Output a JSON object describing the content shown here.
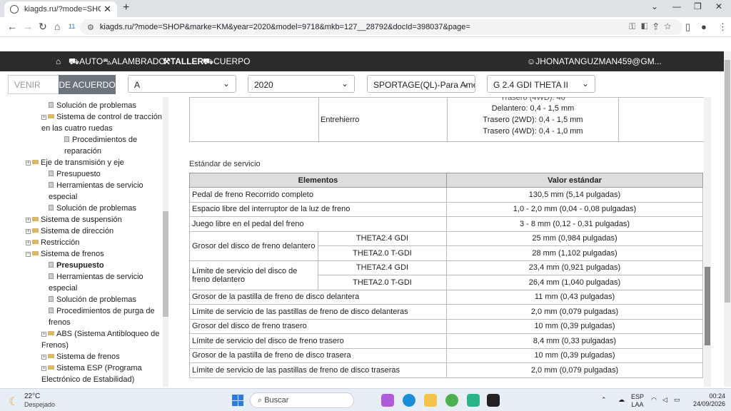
{
  "browser": {
    "tab_title": "kiagds.ru/?mode=SHOP&marke",
    "tab_close": "✕",
    "new_tab": "+",
    "profile_badge": "11",
    "url": "kiagds.ru/?mode=SHOP&marke=KM&year=2020&model=9718&mkb=127__28792&docId=398037&page="
  },
  "nav": {
    "items": [
      {
        "icon": "home-icon",
        "label": ""
      },
      {
        "icon": "car-icon",
        "label": "AUTO"
      },
      {
        "icon": "car-wiring-icon",
        "label": "ALAMBRADO"
      },
      {
        "icon": "hammer-icon",
        "label": "TALLER"
      },
      {
        "icon": "truck-icon",
        "label": "CUERPO"
      }
    ],
    "user": "JHONATANGUZMAN459@GM..."
  },
  "filter": {
    "venir_placeholder": "VENIR",
    "submit_label": "DE ACUERDO",
    "selects": [
      "A",
      "2020",
      "SPORTAGE(QL)-Para Amé",
      "G 2.4 GDI THETA II"
    ]
  },
  "sidebar": {
    "items": [
      "Solución de problemas",
      "Sistema de control de tracción en las cuatro ruedas",
      "Procedimientos de reparación",
      "Eje de transmisión y eje",
      "Presupuesto",
      "Herramientas de servicio especial",
      "Solución de problemas",
      "Sistema de suspensión",
      "Sistema de dirección",
      "Restricción",
      "Sistema de frenos",
      "Presupuesto",
      "Herramientas de servicio especial",
      "Solución de problemas",
      "Procedimientos de purga de frenos",
      "ABS (Sistema Antibloqueo de Frenos)",
      "Sistema de frenos",
      "Sistema ESP (Programa Electrónico de Estabilidad)"
    ]
  },
  "top_table": {
    "clipped_text": "Trasero (4WD): 40",
    "label": "Entrehierro",
    "values": [
      "Delantero: 0,4 - 1,5 mm",
      "Trasero (2WD): 0,4 - 1,5 mm",
      "Trasero (4WD): 0,4 - 1,0 mm"
    ]
  },
  "spec": {
    "section_title": "Estándar de servicio",
    "col_elements": "Elementos",
    "col_value": "Valor estándar",
    "rows": [
      {
        "item": "Pedal de freno Recorrido completo",
        "value": "130,5 mm (5,14 pulgadas)"
      },
      {
        "item": "Espacio libre del interruptor de la luz de freno",
        "value": "1,0 - 2,0 mm (0,04 - 0,08 pulgadas)"
      },
      {
        "item": "Juego libre en el pedal del freno",
        "value": "3 - 8 mm (0,12 - 0,31 pulgadas)"
      }
    ],
    "group1": {
      "item": "Grosor del disco de freno delantero",
      "sub1": "THETA2.4 GDI",
      "val1": "25 mm (0,984 pulgadas)",
      "sub2": "THETA2.0 T-GDI",
      "val2": "28 mm (1,102 pulgadas)"
    },
    "group2": {
      "item": "Límite de servicio del disco de freno delantero",
      "sub1": "THETA2.4 GDI",
      "val1": "23,4 mm (0,921 pulgadas)",
      "sub2": "THETA2.0 T-GDI",
      "val2": "26,4 mm (1,040 pulgadas)"
    },
    "rows2": [
      {
        "item": "Grosor de la pastilla de freno de disco delantera",
        "value": "11 mm (0,43 pulgadas)"
      },
      {
        "item": "Límite de servicio de las pastillas de freno de disco delanteras",
        "value": "2,0 mm (0,079 pulgadas)"
      },
      {
        "item": "Grosor del disco de freno trasero",
        "value": "10 mm (0,39 pulgadas)"
      },
      {
        "item": "Límite de servicio del disco de freno trasero",
        "value": "8,4 mm (0,33 pulgadas)"
      },
      {
        "item": "Grosor de la pastilla de freno de disco trasera",
        "value": "10 mm (0,39 pulgadas)"
      },
      {
        "item": "Límite de servicio de las pastillas de freno de disco traseras",
        "value": "2,0 mm (0,079 pulgadas)"
      }
    ]
  },
  "taskbar": {
    "temp": "22°C",
    "weather": "Despejado",
    "search_placeholder": "Buscar",
    "lang1": "ESP",
    "lang2": "LAA",
    "time": "00:24",
    "date": "24/09/2026"
  }
}
